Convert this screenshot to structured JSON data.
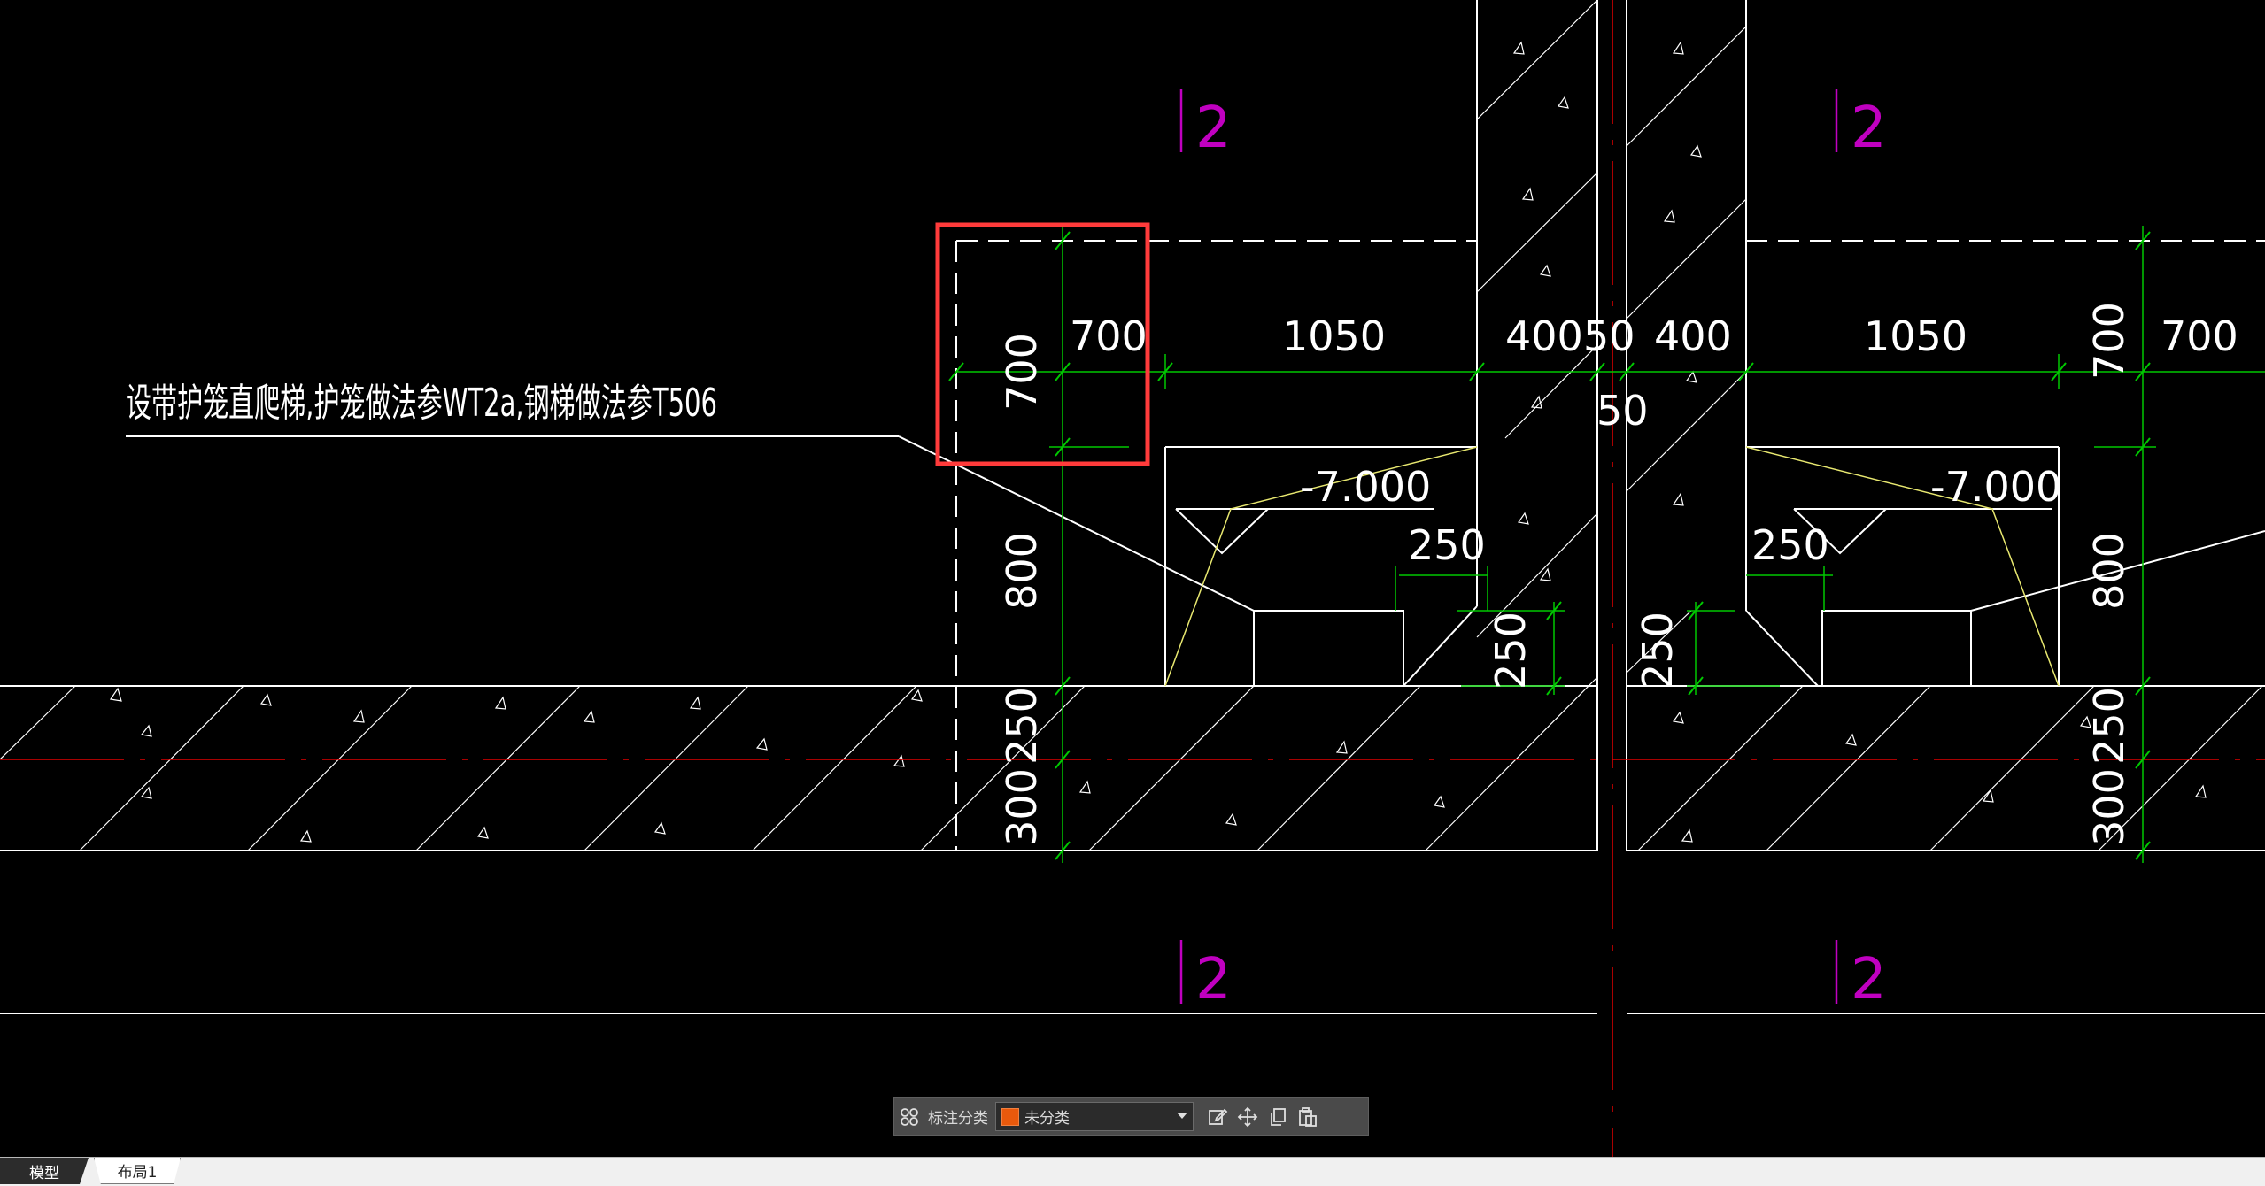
{
  "drawing": {
    "note_text": "设带护笼直爬梯,护笼做法参WT2a,钢梯做法参T506",
    "dims": {
      "d700_h_left": "700",
      "d700_v_left": "700",
      "d1050_left": "1050",
      "d400_left": "400",
      "d50_top": "50",
      "d400_right": "400",
      "d50_mid": "50",
      "d1050_right": "1050",
      "d700_v_right": "700",
      "d700_h_right": "700",
      "d800_left": "800",
      "d800_right": "800",
      "d250_left_small": "250",
      "d250_left_vert": "250",
      "d250_right_vert": "250",
      "d250_right_small": "250",
      "d250_left_bottom": "250",
      "d300_left_bottom": "300",
      "d250_right_bottom": "250",
      "d300_right_bottom": "300"
    },
    "levels": {
      "left": "-7.000",
      "right": "-7.000"
    },
    "section_marks": {
      "top_left": "2",
      "top_right": "2",
      "bottom_left": "2",
      "bottom_right": "2"
    },
    "colors": {
      "background": "#000000",
      "line_white": "#ffffff",
      "dim_green": "#00c800",
      "axis_red": "#e00000",
      "section_magenta": "#c000c0",
      "leader_yellow": "#e8e870",
      "highlight_red": "#ff3b3b"
    }
  },
  "toolbar": {
    "grid_icon": "grid-icon",
    "label": "标注分类",
    "select_value": "未分类",
    "swatch_color": "#e8590c",
    "icons": [
      "edit-icon",
      "move-icon",
      "copy-icon",
      "paste-icon"
    ]
  },
  "tabs": {
    "model": "模型",
    "layout1": "布局1"
  }
}
